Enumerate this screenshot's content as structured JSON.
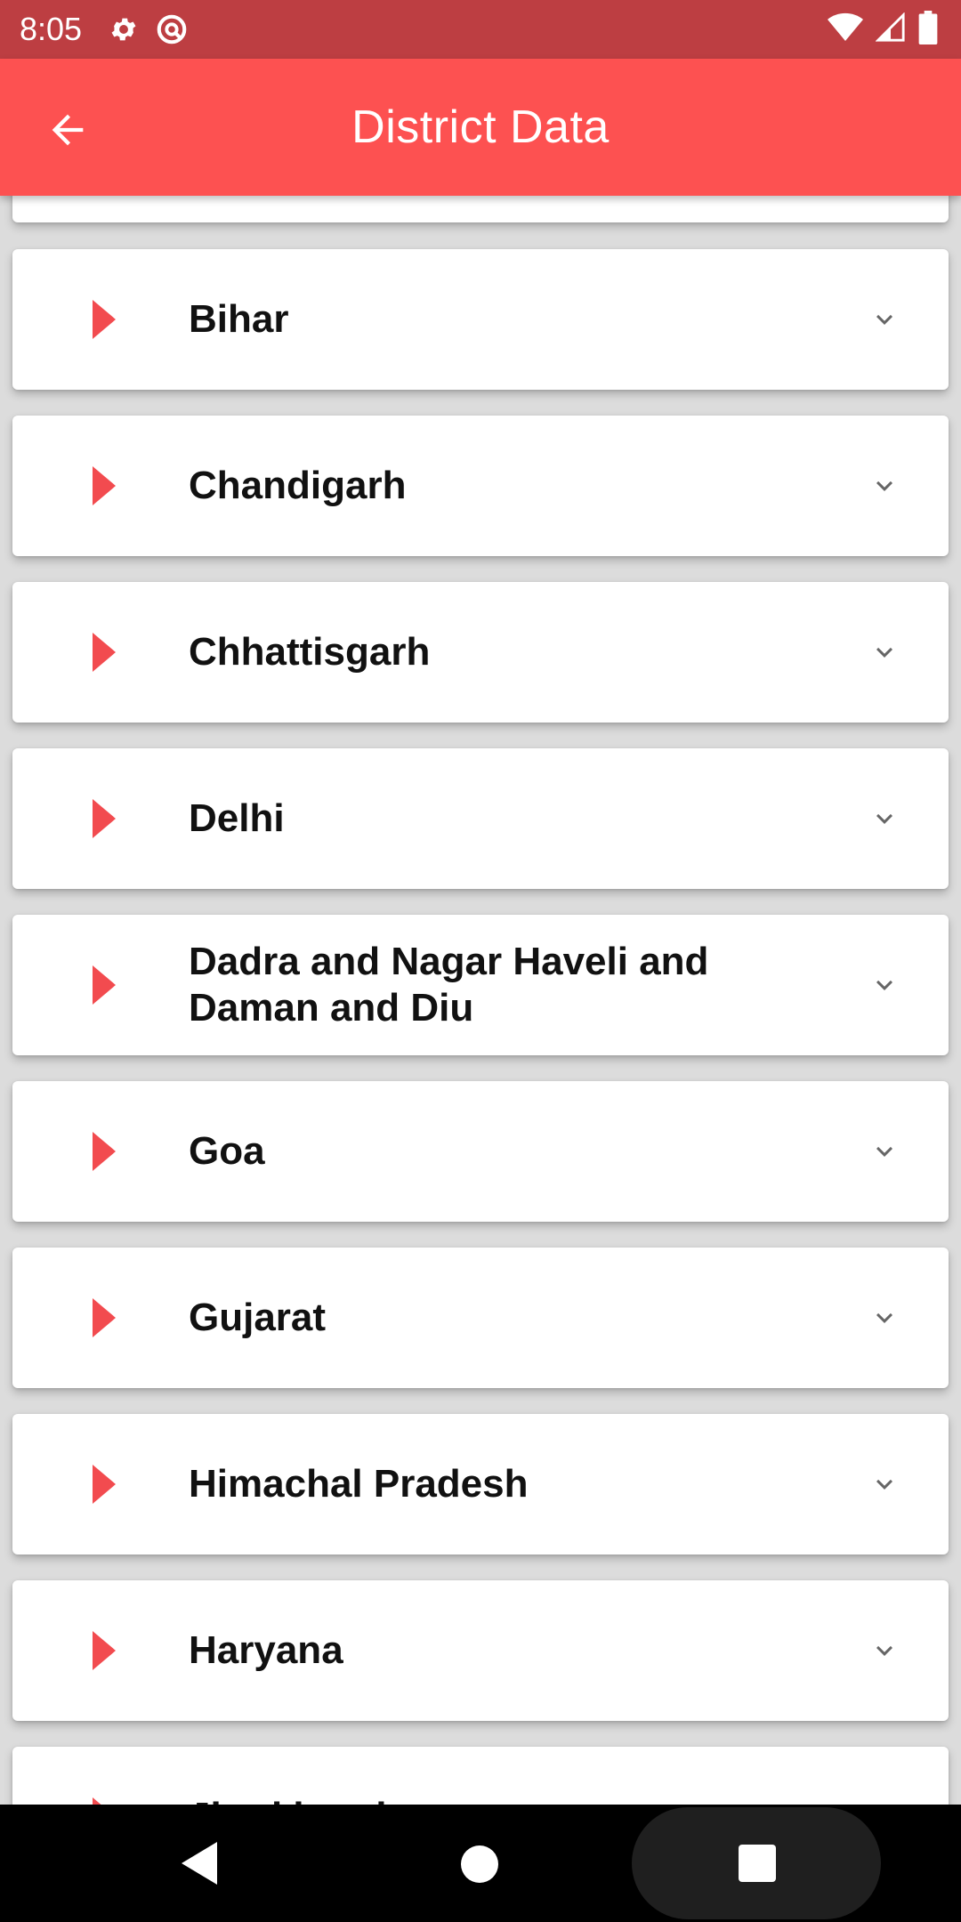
{
  "status_bar": {
    "time": "8:05"
  },
  "app_bar": {
    "title": "District Data"
  },
  "states": [
    {
      "name": "Bihar"
    },
    {
      "name": "Chandigarh"
    },
    {
      "name": "Chhattisgarh"
    },
    {
      "name": "Delhi"
    },
    {
      "name": "Dadra and Nagar Haveli and Daman and Diu"
    },
    {
      "name": "Goa"
    },
    {
      "name": "Gujarat"
    },
    {
      "name": "Himachal Pradesh"
    },
    {
      "name": "Haryana"
    },
    {
      "name": "Jharkhand"
    }
  ],
  "colors": {
    "status_bar": "#bd3e42",
    "app_bar": "#fd5151",
    "accent_triangle": "#f24b4f",
    "background": "#dcdcdc"
  },
  "icons": {
    "back": "arrow-left-icon",
    "expand": "chevron-down-icon",
    "marker": "triangle-right-icon"
  }
}
